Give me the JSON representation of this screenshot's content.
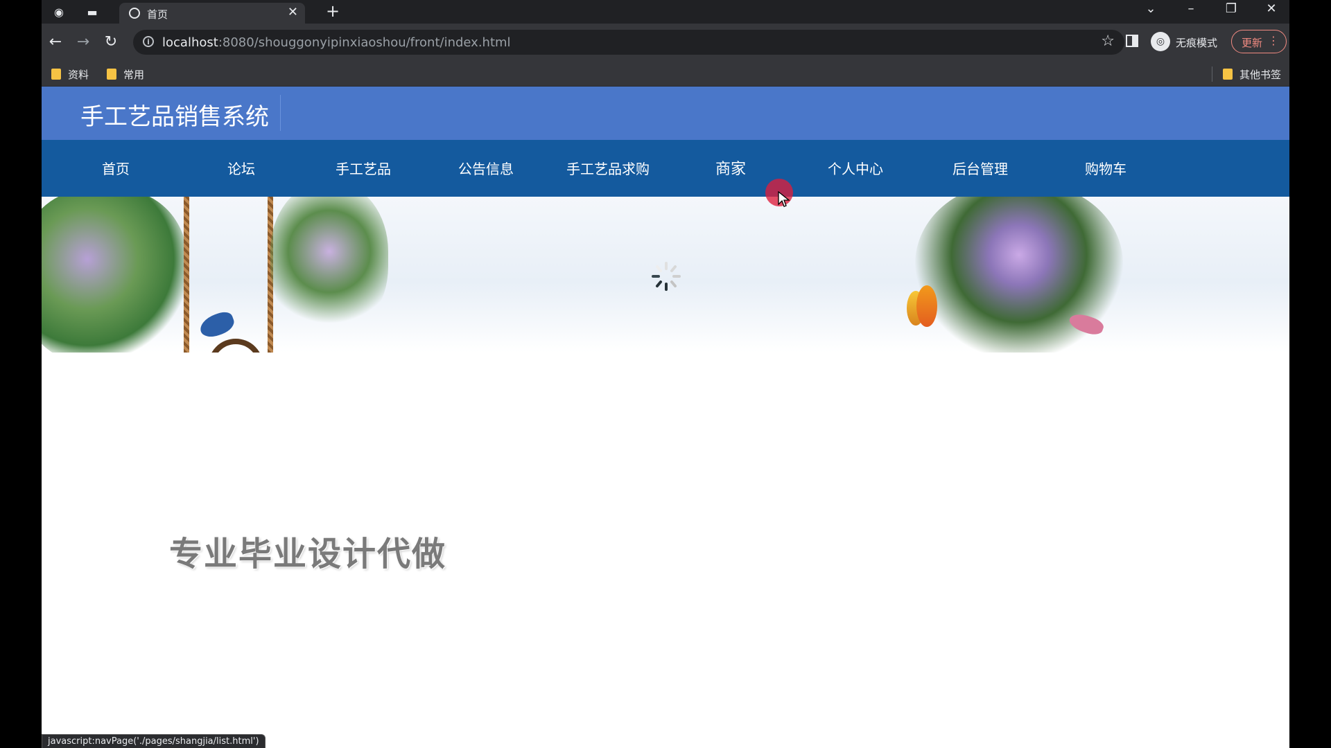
{
  "browser": {
    "tab_title": "首页",
    "url_host": "localhost",
    "url_rest": ":8080/shouggonyipinxiaoshou/front/index.html",
    "incognito_label": "无痕模式",
    "update_label": "更新",
    "bookmarks": [
      {
        "label": "资料"
      },
      {
        "label": "常用"
      }
    ],
    "other_bookmarks": "其他书签",
    "status_url": "javascript:navPage('./pages/shangjia/list.html')"
  },
  "site": {
    "title": "手工艺品销售系统",
    "nav": [
      {
        "label": "首页"
      },
      {
        "label": "论坛"
      },
      {
        "label": "手工艺品"
      },
      {
        "label": "公告信息"
      },
      {
        "label": "手工艺品求购"
      },
      {
        "label": "商家"
      },
      {
        "label": "个人中心"
      },
      {
        "label": "后台管理"
      },
      {
        "label": "购物车"
      }
    ],
    "hovered_nav": "商家",
    "banner_caption": "专业毕业设计代做"
  },
  "colors": {
    "header_bg": "#4a77c9",
    "nav_bg": "#145a9e",
    "cursor_highlight": "#dc1e3c"
  }
}
